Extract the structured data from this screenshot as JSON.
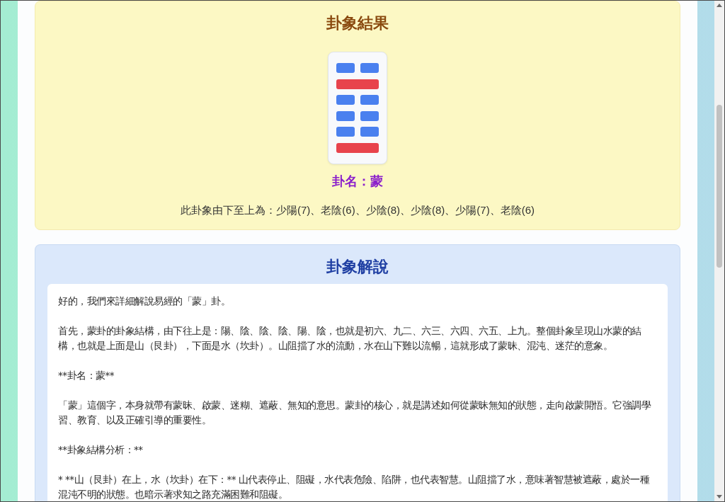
{
  "result": {
    "title": "卦象結果",
    "hexagram": {
      "lines": [
        {
          "kind": "broken"
        },
        {
          "kind": "solid"
        },
        {
          "kind": "broken"
        },
        {
          "kind": "broken"
        },
        {
          "kind": "broken"
        },
        {
          "kind": "solid"
        }
      ]
    },
    "name": "卦名：蒙",
    "sequence": "此卦象由下至上為：少陽(7)、老陰(6)、少陰(8)、少陰(8)、少陽(7)、老陰(6)"
  },
  "interpretation": {
    "title": "卦象解說",
    "paragraphs": [
      "好的，我們來詳細解說易經的「蒙」卦。",
      "首先，蒙卦的卦象結構，由下往上是：陽、陰、陰、陰、陽、陰，也就是初六、九二、六三、六四、六五、上九。整個卦象呈現山水蒙的結構，也就是上面是山（艮卦），下面是水（坎卦）。山阻擋了水的流動，水在山下難以流暢，這就形成了蒙昧、混沌、迷茫的意象。",
      "**卦名：蒙**",
      "「蒙」這個字，本身就帶有蒙昧、啟蒙、迷糊、遮蔽、無知的意思。蒙卦的核心，就是講述如何從蒙昧無知的狀態，走向啟蒙開悟。它強調學習、教育、以及正確引導的重要性。",
      "**卦象結構分析：**",
      "* **山（艮卦）在上，水（坎卦）在下：** 山代表停止、阻礙，水代表危險、陷阱，也代表智慧。山阻擋了水，意味著智慧被遮蔽，處於一種混沌不明的狀態。也暗示著求知之路充滿困難和阻礙。"
    ]
  }
}
